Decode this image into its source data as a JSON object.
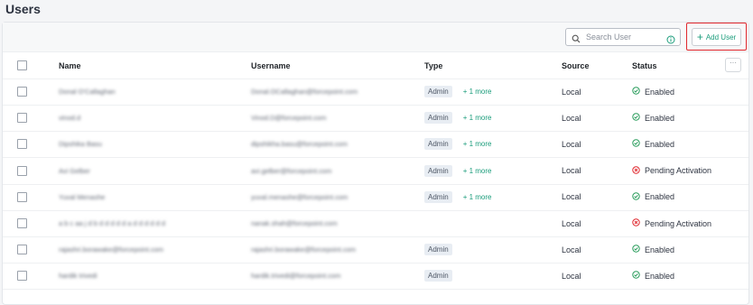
{
  "page": {
    "title": "Users"
  },
  "toolbar": {
    "search_placeholder": "Search User",
    "add_user_label": "Add User",
    "add_user_icon": "plus-icon",
    "search_icon": "search-icon",
    "info_icon": "info-icon"
  },
  "table": {
    "headers": {
      "name": "Name",
      "username": "Username",
      "type": "Type",
      "source": "Source",
      "status": "Status"
    },
    "rows": [
      {
        "name": "Donal O'Callaghan",
        "username": "Donal.OCallaghan@forcepoint.com",
        "type": "Admin",
        "more": "+ 1 more",
        "source": "Local",
        "status": "Enabled",
        "status_kind": "enabled"
      },
      {
        "name": "vinod.d",
        "username": "Vinod.D@forcepoint.com",
        "type": "Admin",
        "more": "+ 1 more",
        "source": "Local",
        "status": "Enabled",
        "status_kind": "enabled"
      },
      {
        "name": "Dipshika Basu",
        "username": "dipshikha.basu@forcepoint.com",
        "type": "Admin",
        "more": "+ 1 more",
        "source": "Local",
        "status": "Enabled",
        "status_kind": "enabled"
      },
      {
        "name": "Avi Gelber",
        "username": "avi.gelber@forcepoint.com",
        "type": "Admin",
        "more": "+ 1 more",
        "source": "Local",
        "status": "Pending Activation",
        "status_kind": "pending"
      },
      {
        "name": "Yuval Menashe",
        "username": "yuval.menashe@forcepoint.com",
        "type": "Admin",
        "more": "+ 1 more",
        "source": "Local",
        "status": "Enabled",
        "status_kind": "enabled"
      },
      {
        "name": "a b c aa j d b d d d d d a d d d d d d",
        "username": "nanak.shah@forcepoint.com",
        "type": "",
        "more": "",
        "source": "Local",
        "status": "Pending Activation",
        "status_kind": "pending"
      },
      {
        "name": "rajashri.borawake@forcepoint.com",
        "username": "rajashri.borawake@forcepoint.com",
        "type": "Admin",
        "more": "",
        "source": "Local",
        "status": "Enabled",
        "status_kind": "enabled"
      },
      {
        "name": "hardik trivedi",
        "username": "hardik.trivedi@forcepoint.com",
        "type": "Admin",
        "more": "",
        "source": "Local",
        "status": "Enabled",
        "status_kind": "enabled"
      }
    ]
  },
  "colors": {
    "accent": "#1a9c7b",
    "enabled": "#2a9d5c",
    "pending": "#e0282e",
    "highlight_outline": "#e0282e"
  }
}
